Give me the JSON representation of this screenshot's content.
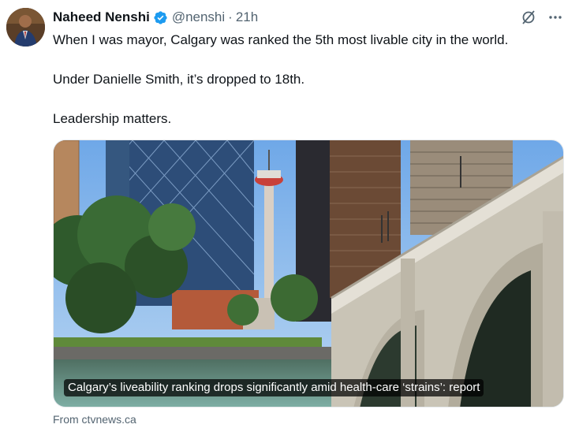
{
  "author": {
    "display_name": "Naheed Nenshi",
    "handle": "@nenshi",
    "separator": "·",
    "time": "21h",
    "verified_icon": "verified-badge-icon",
    "verified_color": "#1d9bf0"
  },
  "tweet": {
    "paragraphs": [
      "When I was mayor, Calgary was ranked the 5th most livable city in the world.",
      "Under Danielle Smith, it’s dropped to 18th.",
      "Leadership matters."
    ]
  },
  "card": {
    "title": "Calgary’s liveability ranking drops significantly amid health-care ‘strains’: report",
    "source": "From ctvnews.ca",
    "image_icon": "calgary-skyline-photo"
  },
  "actions": {
    "grok_icon": "grok-icon",
    "more_icon": "more-options-icon"
  }
}
